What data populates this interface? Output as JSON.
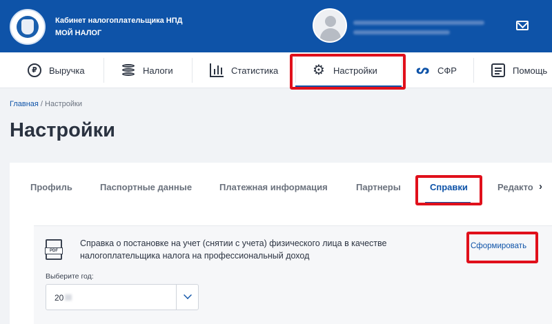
{
  "header": {
    "brand_line1": "Кабинет налогоплательщика НПД",
    "brand_line2": "МОЙ НАЛОГ",
    "logo_icon": "fns-emblem-icon",
    "mail_icon": "mail-icon"
  },
  "nav": {
    "items": [
      {
        "label": "Выручка",
        "icon": "ruble-icon"
      },
      {
        "label": "Налоги",
        "icon": "coins-icon"
      },
      {
        "label": "Статистика",
        "icon": "chart-icon"
      },
      {
        "label": "Настройки",
        "icon": "gear-icon"
      },
      {
        "label": "СФР",
        "icon": "sfr-icon"
      },
      {
        "label": "Помощь",
        "icon": "help-icon"
      }
    ],
    "active": "Настройки"
  },
  "breadcrumb": {
    "home": "Главная",
    "separator": " / ",
    "current": "Настройки"
  },
  "page": {
    "title": "Настройки"
  },
  "tabs": {
    "items": [
      "Профиль",
      "Паспортные данные",
      "Платежная информация",
      "Партнеры",
      "Справки",
      "Редакто"
    ],
    "active": "Справки",
    "next_glyph": "›"
  },
  "document": {
    "text_line1": "Справка о постановке на учет (снятии с учета) физического лица в качестве",
    "text_line2": "налогоплательщика налога на профессиональный доход",
    "action_label": "Сформировать",
    "pdf_label": "PDF"
  },
  "year_select": {
    "label": "Выберите год:",
    "value": "20"
  },
  "colors": {
    "brand_blue": "#0e53a8",
    "highlight_red": "#e0101b"
  }
}
